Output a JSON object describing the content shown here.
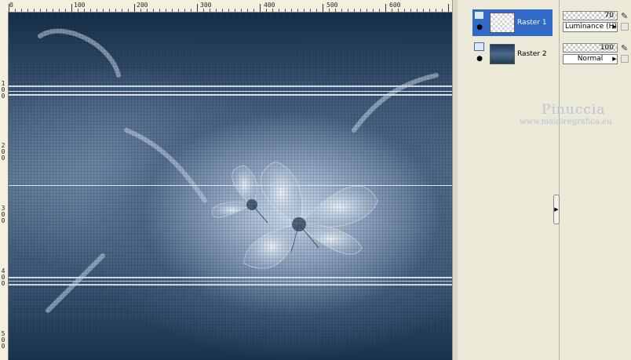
{
  "ruler": {
    "top_labels": [
      "0",
      "100",
      "200",
      "300",
      "400",
      "500",
      "600"
    ],
    "left_labels": [
      "1",
      "0",
      "0",
      "2",
      "0",
      "0",
      "3",
      "0",
      "0",
      "4",
      "0",
      "0",
      "5",
      "0",
      "0"
    ]
  },
  "layers": [
    {
      "name": "Raster 1",
      "selected": true,
      "thumb": "checker",
      "icon": "layer-icon",
      "visibility": "eye-icon"
    },
    {
      "name": "Raster 2",
      "selected": false,
      "thumb": "dark",
      "icon": "layer-icon",
      "visibility": "eye-icon"
    }
  ],
  "properties": [
    {
      "opacity": "70",
      "blend_mode": "Luminance (H)"
    },
    {
      "opacity": "100",
      "blend_mode": "Normal"
    }
  ],
  "watermark": {
    "title": "Pinuccia",
    "url": "www.maidiregrafica.eu"
  },
  "colors": {
    "panel_bg": "#ece9d8",
    "selection": "#3169c6",
    "canvas_dark": "#1a3450",
    "canvas_light": "#d7e4f5"
  }
}
